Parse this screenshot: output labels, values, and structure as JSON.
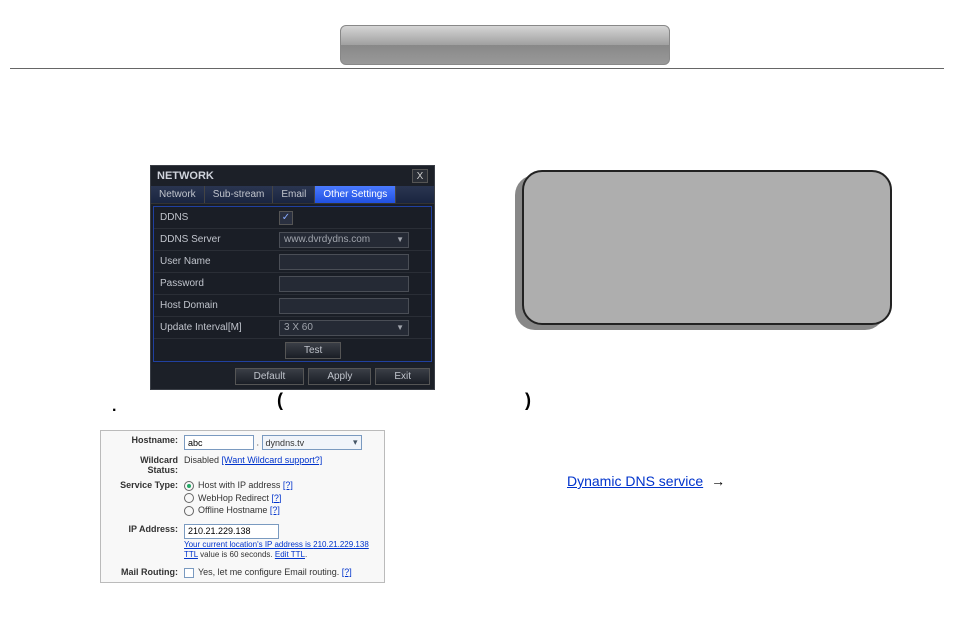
{
  "network_dialog": {
    "title": "NETWORK",
    "close_icon": "X",
    "tabs": [
      "Network",
      "Sub-stream",
      "Email",
      "Other Settings"
    ],
    "active_tab_index": 3,
    "rows": {
      "ddns_label": "DDNS",
      "ddns_checked": true,
      "server_label": "DDNS Server",
      "server_value": "www.dvrdydns.com",
      "username_label": "User Name",
      "username_value": "",
      "password_label": "Password",
      "password_value": "",
      "host_label": "Host Domain",
      "host_value": "",
      "interval_label": "Update Interval[M]",
      "interval_value": "3 X 60",
      "test_label": "Test"
    },
    "footer": {
      "default": "Default",
      "apply": "Apply",
      "exit": "Exit"
    }
  },
  "punct": {
    "dot": ".",
    "lparen": "(",
    "rparen": ")"
  },
  "dyndns": {
    "hostname_label": "Hostname:",
    "hostname_value": "abc",
    "hostname_dot": ".",
    "hostname_suffix": "dyndns.tv",
    "wildcard_label": "Wildcard Status:",
    "wildcard_status": "Disabled",
    "wildcard_link": "[Want Wildcard support?]",
    "service_label": "Service Type:",
    "service_options": [
      {
        "label": "Host with IP address",
        "q": "[?]",
        "selected": true
      },
      {
        "label": "WebHop Redirect",
        "q": "[?]",
        "selected": false
      },
      {
        "label": "Offline Hostname",
        "q": "[?]",
        "selected": false
      }
    ],
    "ip_label": "IP Address:",
    "ip_value": "210.21.229.138",
    "ip_hint_prefix": "Your current location's IP address is ",
    "ip_hint_ip": "210.21.229.138",
    "ttl_prefix": "TTL",
    "ttl_mid": " value is 60 seconds. ",
    "ttl_link": "Edit TTL",
    "ttl_dot": ".",
    "mail_label": "Mail Routing:",
    "mail_text": "Yes, let me configure Email routing.",
    "mail_q": "[?]"
  },
  "dns_link": {
    "text": "Dynamic DNS service",
    "arrow": "→"
  }
}
